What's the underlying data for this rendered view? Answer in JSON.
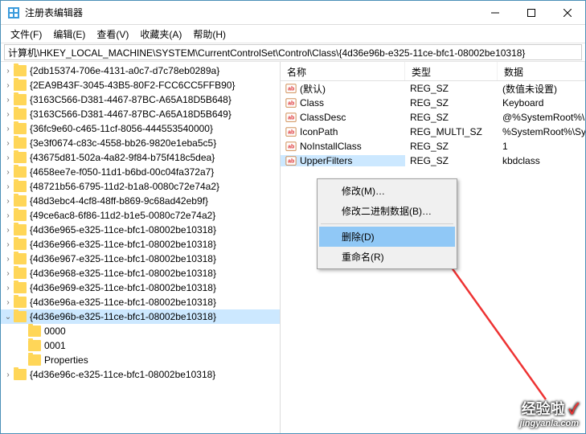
{
  "window": {
    "title": "注册表编辑器"
  },
  "menu": {
    "file": "文件(F)",
    "edit": "编辑(E)",
    "view": "查看(V)",
    "favorites": "收藏夹(A)",
    "help": "帮助(H)"
  },
  "address": "计算机\\HKEY_LOCAL_MACHINE\\SYSTEM\\CurrentControlSet\\Control\\Class\\{4d36e96b-e325-11ce-bfc1-08002be10318}",
  "tree": [
    {
      "label": "{2db15374-706e-4131-a0c7-d7c78eb0289a}",
      "indent": 0,
      "twisty": "›"
    },
    {
      "label": "{2EA9B43F-3045-43B5-80F2-FCC6CC5FFB90}",
      "indent": 0,
      "twisty": "›"
    },
    {
      "label": "{3163C566-D381-4467-87BC-A65A18D5B648}",
      "indent": 0,
      "twisty": "›"
    },
    {
      "label": "{3163C566-D381-4467-87BC-A65A18D5B649}",
      "indent": 0,
      "twisty": "›"
    },
    {
      "label": "{36fc9e60-c465-11cf-8056-444553540000}",
      "indent": 0,
      "twisty": "›"
    },
    {
      "label": "{3e3f0674-c83c-4558-bb26-9820e1eba5c5}",
      "indent": 0,
      "twisty": "›"
    },
    {
      "label": "{43675d81-502a-4a82-9f84-b75f418c5dea}",
      "indent": 0,
      "twisty": "›"
    },
    {
      "label": "{4658ee7e-f050-11d1-b6bd-00c04fa372a7}",
      "indent": 0,
      "twisty": "›"
    },
    {
      "label": "{48721b56-6795-11d2-b1a8-0080c72e74a2}",
      "indent": 0,
      "twisty": "›"
    },
    {
      "label": "{48d3ebc4-4cf8-48ff-b869-9c68ad42eb9f}",
      "indent": 0,
      "twisty": "›"
    },
    {
      "label": "{49ce6ac8-6f86-11d2-b1e5-0080c72e74a2}",
      "indent": 0,
      "twisty": "›"
    },
    {
      "label": "{4d36e965-e325-11ce-bfc1-08002be10318}",
      "indent": 0,
      "twisty": "›"
    },
    {
      "label": "{4d36e966-e325-11ce-bfc1-08002be10318}",
      "indent": 0,
      "twisty": "›"
    },
    {
      "label": "{4d36e967-e325-11ce-bfc1-08002be10318}",
      "indent": 0,
      "twisty": "›"
    },
    {
      "label": "{4d36e968-e325-11ce-bfc1-08002be10318}",
      "indent": 0,
      "twisty": "›"
    },
    {
      "label": "{4d36e969-e325-11ce-bfc1-08002be10318}",
      "indent": 0,
      "twisty": "›"
    },
    {
      "label": "{4d36e96a-e325-11ce-bfc1-08002be10318}",
      "indent": 0,
      "twisty": "›"
    },
    {
      "label": "{4d36e96b-e325-11ce-bfc1-08002be10318}",
      "indent": 0,
      "twisty": "⌄",
      "selected": true
    },
    {
      "label": "0000",
      "indent": 1,
      "twisty": ""
    },
    {
      "label": "0001",
      "indent": 1,
      "twisty": ""
    },
    {
      "label": "Properties",
      "indent": 1,
      "twisty": ""
    },
    {
      "label": "{4d36e96c-e325-11ce-bfc1-08002be10318}",
      "indent": 0,
      "twisty": "›"
    }
  ],
  "list": {
    "headers": {
      "name": "名称",
      "type": "类型",
      "data": "数据"
    },
    "rows": [
      {
        "name": "(默认)",
        "type": "REG_SZ",
        "data": "(数值未设置)",
        "selected": false
      },
      {
        "name": "Class",
        "type": "REG_SZ",
        "data": "Keyboard",
        "selected": false
      },
      {
        "name": "ClassDesc",
        "type": "REG_SZ",
        "data": "@%SystemRoot%\\S",
        "selected": false
      },
      {
        "name": "IconPath",
        "type": "REG_MULTI_SZ",
        "data": "%SystemRoot%\\Sys",
        "selected": false
      },
      {
        "name": "NoInstallClass",
        "type": "REG_SZ",
        "data": "1",
        "selected": false
      },
      {
        "name": "UpperFilters",
        "type": "REG_SZ",
        "data": "kbdclass",
        "selected": true
      }
    ]
  },
  "contextmenu": {
    "modify": "修改(M)…",
    "modify_binary": "修改二进制数据(B)…",
    "delete": "删除(D)",
    "rename": "重命名(R)"
  },
  "watermark": {
    "line1": "经验啦",
    "check": "✓",
    "line2": "jingyanla.com"
  }
}
